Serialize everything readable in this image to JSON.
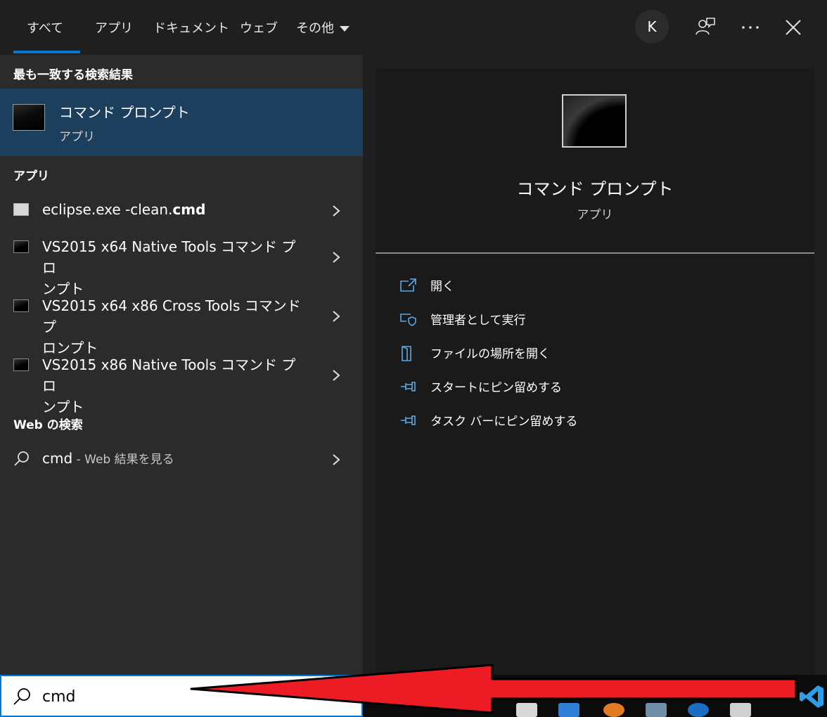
{
  "tabs": [
    {
      "label": "すべて",
      "active": true
    },
    {
      "label": "アプリ",
      "active": false
    },
    {
      "label": "ドキュメント",
      "active": false
    },
    {
      "label": "ウェブ",
      "active": false
    },
    {
      "label": "その他",
      "active": false
    }
  ],
  "header": {
    "avatar_letter": "K",
    "feedback_icon": "feedback-icon",
    "more_icon": "more-icon",
    "close_icon": "close-icon"
  },
  "best_match": {
    "heading": "最も一致する検索結果",
    "title": "コマンド プロンプト",
    "subtitle": "アプリ"
  },
  "apps": {
    "heading": "アプリ",
    "items": [
      {
        "prefix": "eclipse.exe -clean.",
        "bold": "cmd",
        "line2": ""
      },
      {
        "prefix": "VS2015 x64 Native Tools コマンド プロ",
        "bold": "",
        "line2": "ンプト"
      },
      {
        "prefix": "VS2015 x64 x86 Cross Tools コマンド プ",
        "bold": "",
        "line2": "ロンプト"
      },
      {
        "prefix": "VS2015 x86 Native Tools コマンド プロ",
        "bold": "",
        "line2": "ンプト"
      }
    ]
  },
  "web": {
    "heading": "Web の検索",
    "query": "cmd",
    "suffix": " - Web 結果を見る"
  },
  "preview": {
    "title": "コマンド プロンプト",
    "subtitle": "アプリ",
    "actions": [
      {
        "label": "開く",
        "icon": "open-icon"
      },
      {
        "label": "管理者として実行",
        "icon": "shield-icon"
      },
      {
        "label": "ファイルの場所を開く",
        "icon": "file-location-icon"
      },
      {
        "label": "スタートにピン留めする",
        "icon": "pin-icon"
      },
      {
        "label": "タスク バーにピン留めする",
        "icon": "pin-icon"
      }
    ]
  },
  "search": {
    "value": "cmd"
  },
  "colors": {
    "accent": "#0078d4",
    "selected_bg": "#1d3f5e",
    "arrow": "#ed1c24"
  }
}
